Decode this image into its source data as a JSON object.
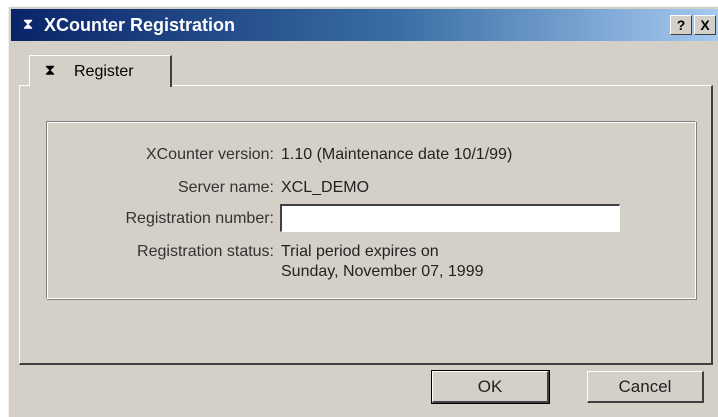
{
  "window": {
    "title": "XCounter Registration",
    "help_label": "?",
    "close_label": "X",
    "icon": "hourglass-icon"
  },
  "tabs": [
    {
      "label": "Register",
      "icon": "hourglass-icon",
      "selected": true
    }
  ],
  "info": {
    "version_label": "XCounter version:",
    "version_value": "1.10  (Maintenance date 10/1/99)",
    "server_label": "Server name:",
    "server_value": "XCL_DEMO",
    "regnum_label": "Registration number:",
    "regnum_value": "",
    "status_label": "Registration status:",
    "status_line1": "Trial period expires on",
    "status_line2": "Sunday, November 07, 1999"
  },
  "buttons": {
    "ok": "OK",
    "cancel": "Cancel"
  },
  "colors": {
    "titlebar_start": "#0a246a",
    "titlebar_end": "#a6caf0",
    "face": "#d4d0c8"
  }
}
